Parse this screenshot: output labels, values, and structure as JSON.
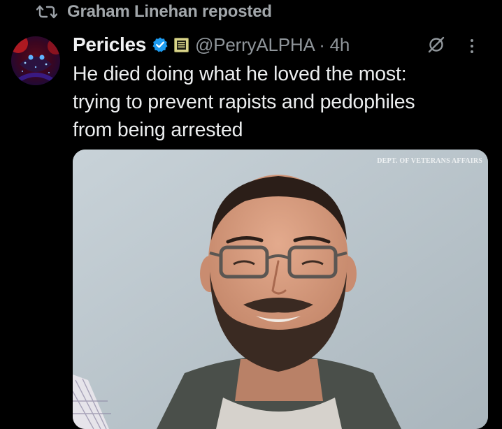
{
  "repost": {
    "icon": "repost-icon",
    "text": "Graham Linehan reposted"
  },
  "post": {
    "display_name": "Pericles",
    "verified_icon": "verified-badge-icon",
    "affiliate_icon": "affiliate-badge-icon",
    "handle_time": "@PerryALPHA · 4h",
    "grok_icon": "grok-icon",
    "more_icon": "more-options-icon",
    "text_lines": [
      "He died doing what he loved the most:",
      "trying to prevent rapists and pedophiles",
      "from being arrested"
    ],
    "media": {
      "watermark": "DEPT. OF VETERANS AFFAIRS"
    }
  },
  "colors": {
    "background": "#000000",
    "text_primary": "#e7e9ea",
    "text_secondary": "#8f959a",
    "verified_blue": "#1d9bf0"
  }
}
